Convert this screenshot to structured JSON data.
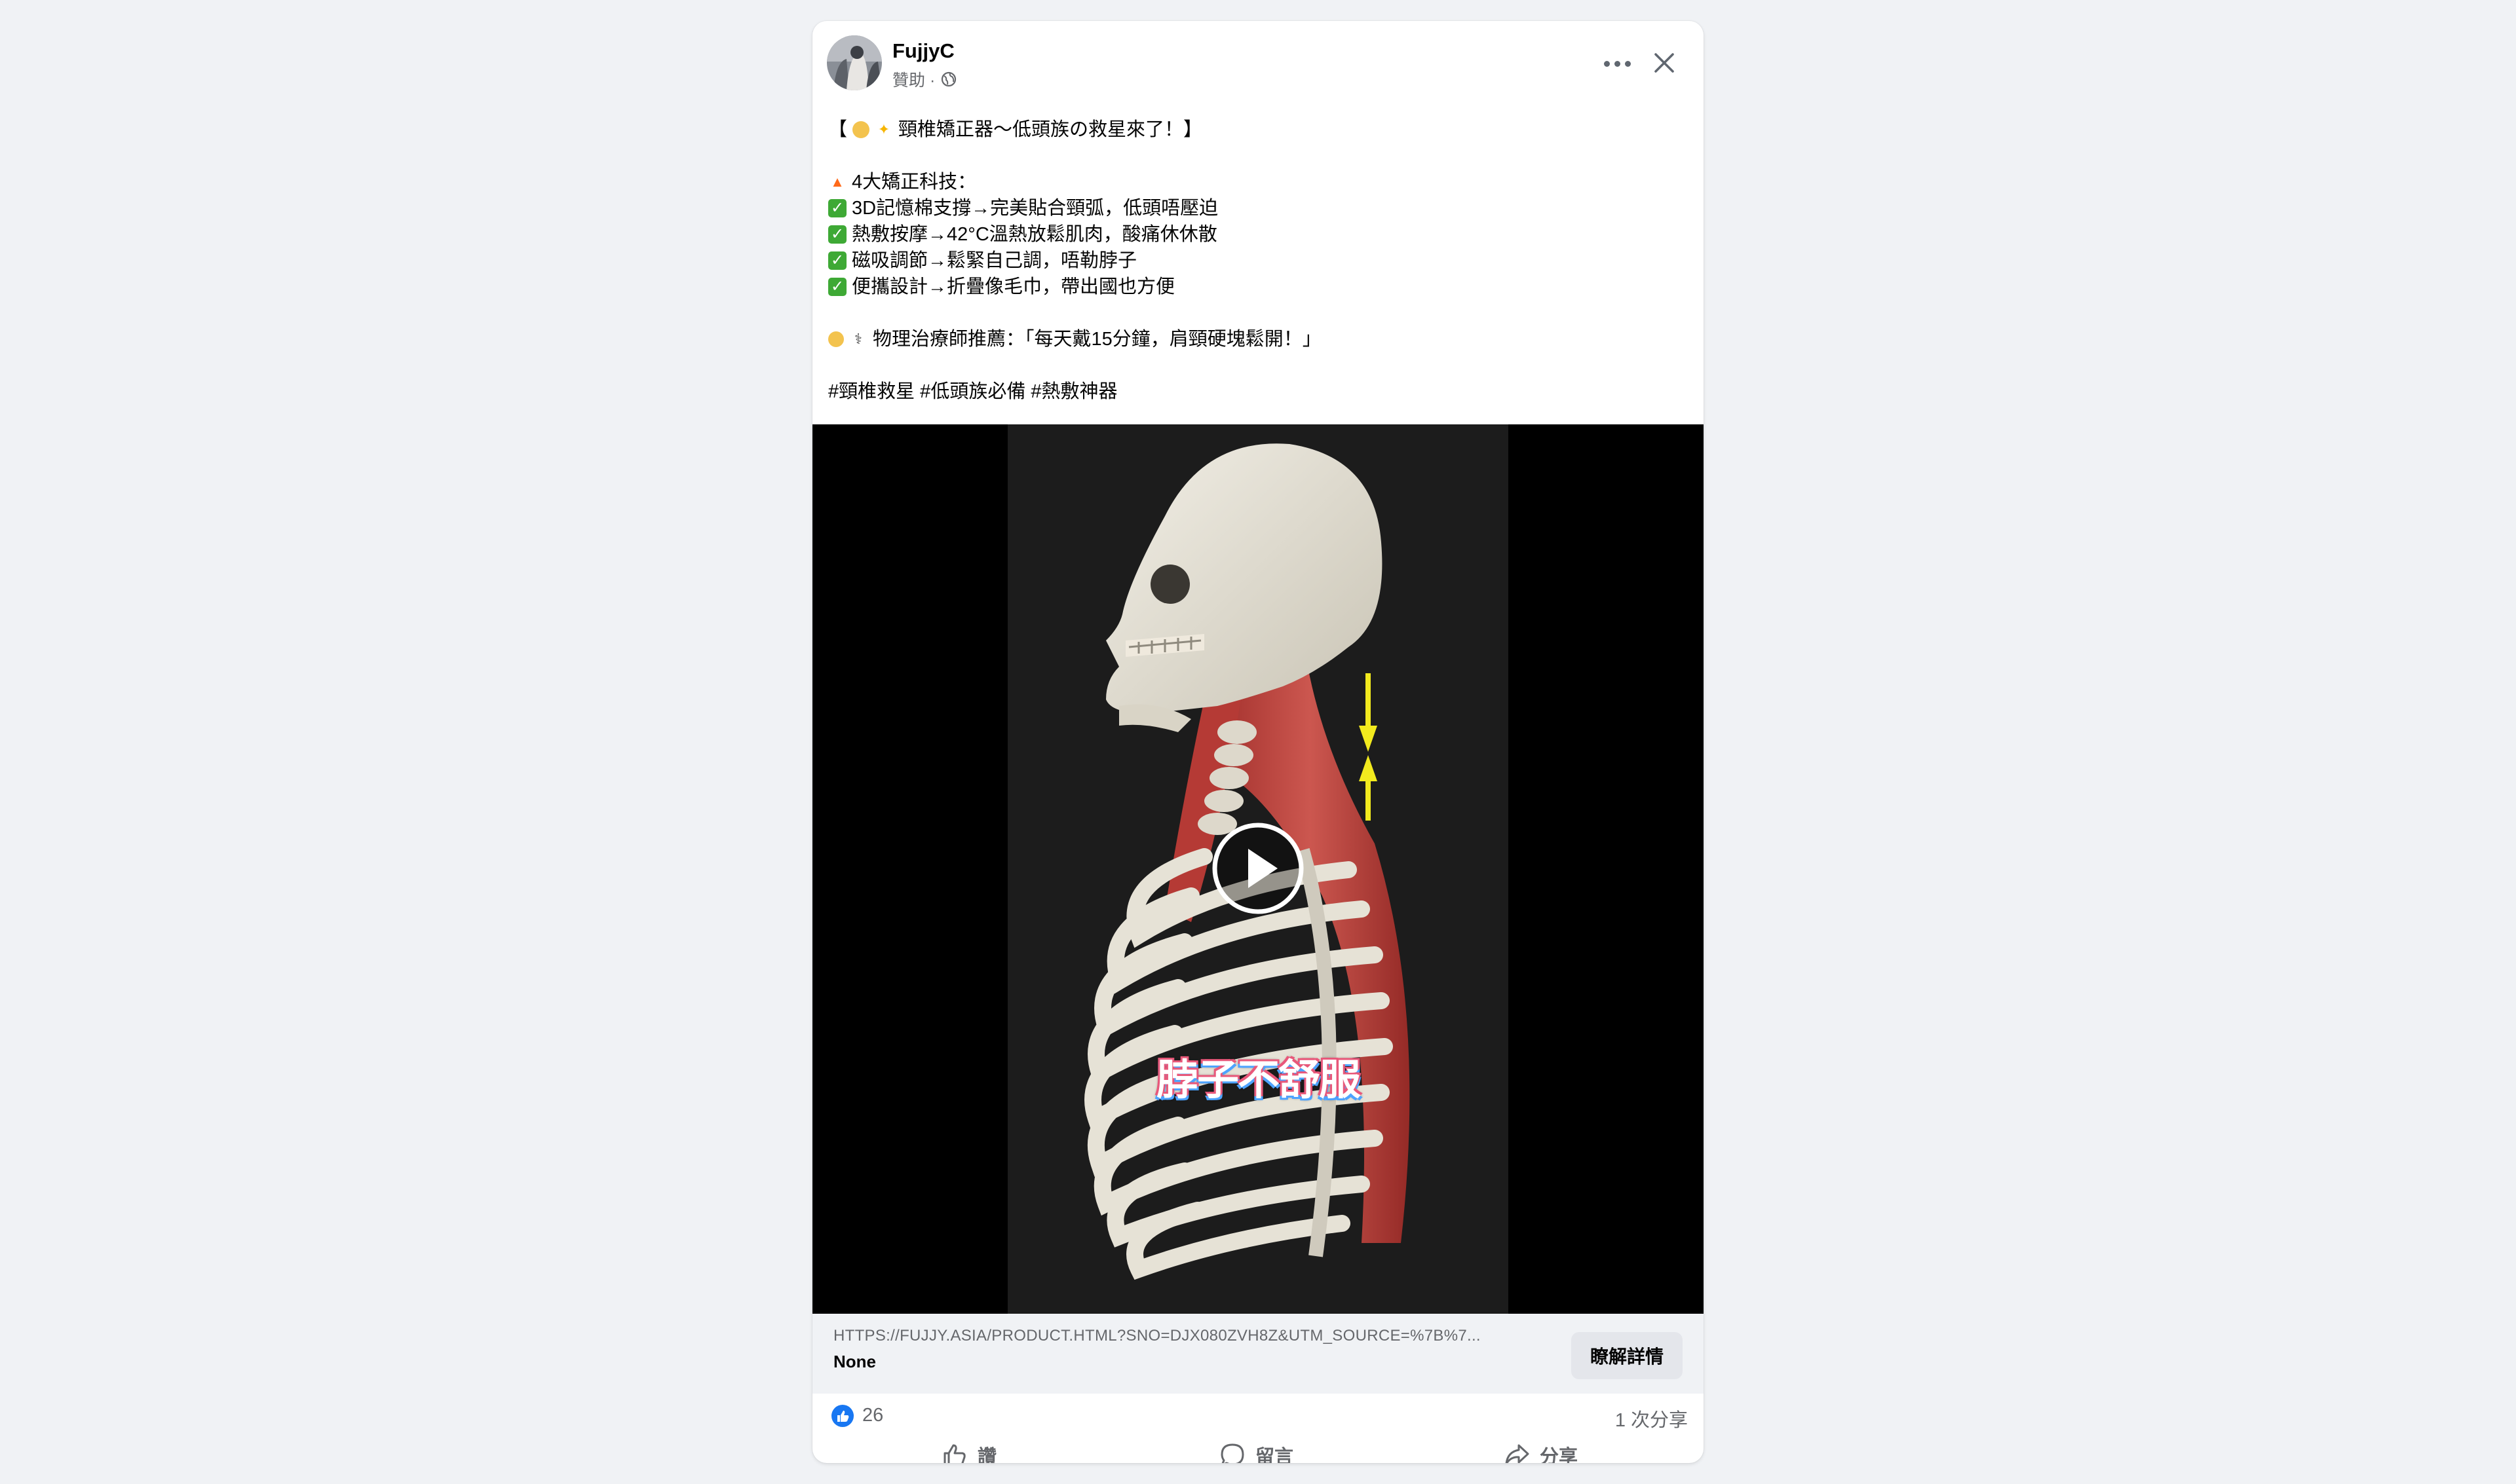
{
  "post": {
    "author": "FujjyC",
    "sponsored_label": "贊助 · ",
    "text_lines": {
      "headline_open": "【",
      "headline": "頸椎矯正器～低頭族の救星來了！】",
      "tech_title": "4大矯正科技：",
      "bullet_1": "3D記憶棉支撐→完美貼合頸弧，低頭唔壓迫",
      "bullet_2": "熱敷按摩→42°C溫熱放鬆肌肉，酸痛休休散",
      "bullet_3": "磁吸調節→鬆緊自己調，唔勒脖子",
      "bullet_4": "便攜設計→折疊像毛巾，帶出國也方便",
      "quote": "物理治療師推薦：「每天戴15分鐘，肩頸硬塊鬆開！」",
      "hashtags": "#頸椎救星 #低頭族必備 #熱敷神器"
    }
  },
  "video": {
    "caption": "脖子不舒服"
  },
  "link": {
    "url": "HTTPS://FUJJY.ASIA/PRODUCT.HTML?SNO=DJX080ZVH8Z&UTM_SOURCE=%7B%7...",
    "title": "None",
    "cta": "瞭解詳情"
  },
  "stats": {
    "reactions": "26",
    "shares": "1 次分享"
  },
  "actions": {
    "like": "讚",
    "comment": "留言",
    "share": "分享"
  },
  "colors": {
    "brand_blue": "#1877f2",
    "check_green": "#3ea935",
    "muscle_red": "#c8453f"
  },
  "icons": [
    "globe-icon",
    "more-icon",
    "close-icon",
    "play-icon",
    "like-icon",
    "comment-icon",
    "share-icon"
  ]
}
